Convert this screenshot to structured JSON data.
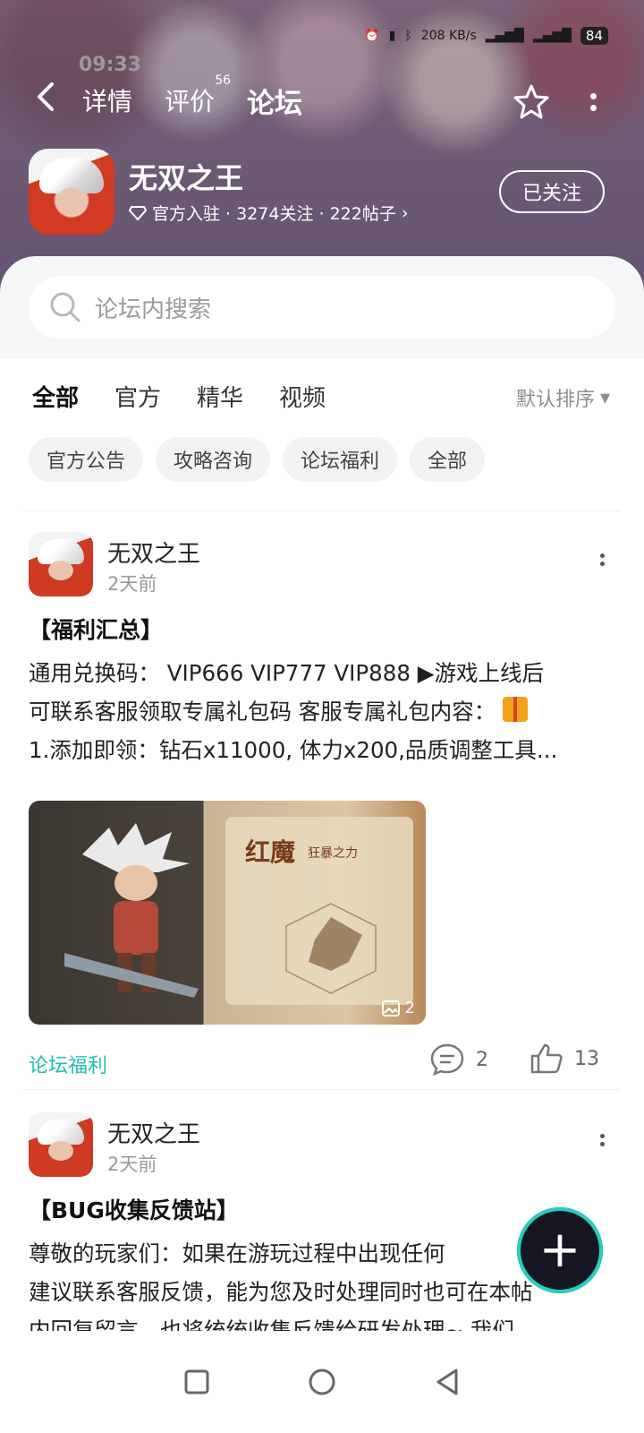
{
  "status_bar": {
    "time": "09:33",
    "net_speed": "208 KB/s",
    "battery": "84"
  },
  "topnav": {
    "tabs": [
      {
        "label": "详情"
      },
      {
        "label": "评价",
        "badge": "56"
      },
      {
        "label": "论坛"
      }
    ]
  },
  "game": {
    "name": "无双之王",
    "meta": "官方入驻 · 3274关注 · 222帖子",
    "follow_label": "已关注"
  },
  "search": {
    "placeholder": "论坛内搜索"
  },
  "filters": {
    "tabs": [
      "全部",
      "官方",
      "精华",
      "视频"
    ],
    "sort_label": "默认排序",
    "chips": [
      "官方公告",
      "攻略咨询",
      "论坛福利",
      "全部"
    ]
  },
  "posts": [
    {
      "author": "无双之王",
      "time": "2天前",
      "title": "【福利汇总】",
      "body_line1": "通用兑换码：  VIP666 VIP777 VIP888 ▶游戏上线后",
      "body_line2": "可联系客服领取专属礼包码 客服专属礼包内容：",
      "body_line3": "1.添加即领：钻石x11000, 体力x200,品质调整工具...",
      "image": {
        "title": "红魔",
        "subtitle": "狂暴之力",
        "count": "2"
      },
      "tag": "论坛福利",
      "comments": "2",
      "likes": "13"
    },
    {
      "author": "无双之王",
      "time": "2天前",
      "title": "【BUG收集反馈站】",
      "body_line1": "尊敬的玩家们：如果在游玩过程中出现任何",
      "body_line2": "建议联系客服反馈，能为您及时处理同时也可在本帖",
      "body_line3": "内回复留言，也将统统收集反馈给研发处理~ 我们"
    }
  ],
  "colors": {
    "accent": "#20d3c2",
    "tag_text": "#20bfb0"
  }
}
